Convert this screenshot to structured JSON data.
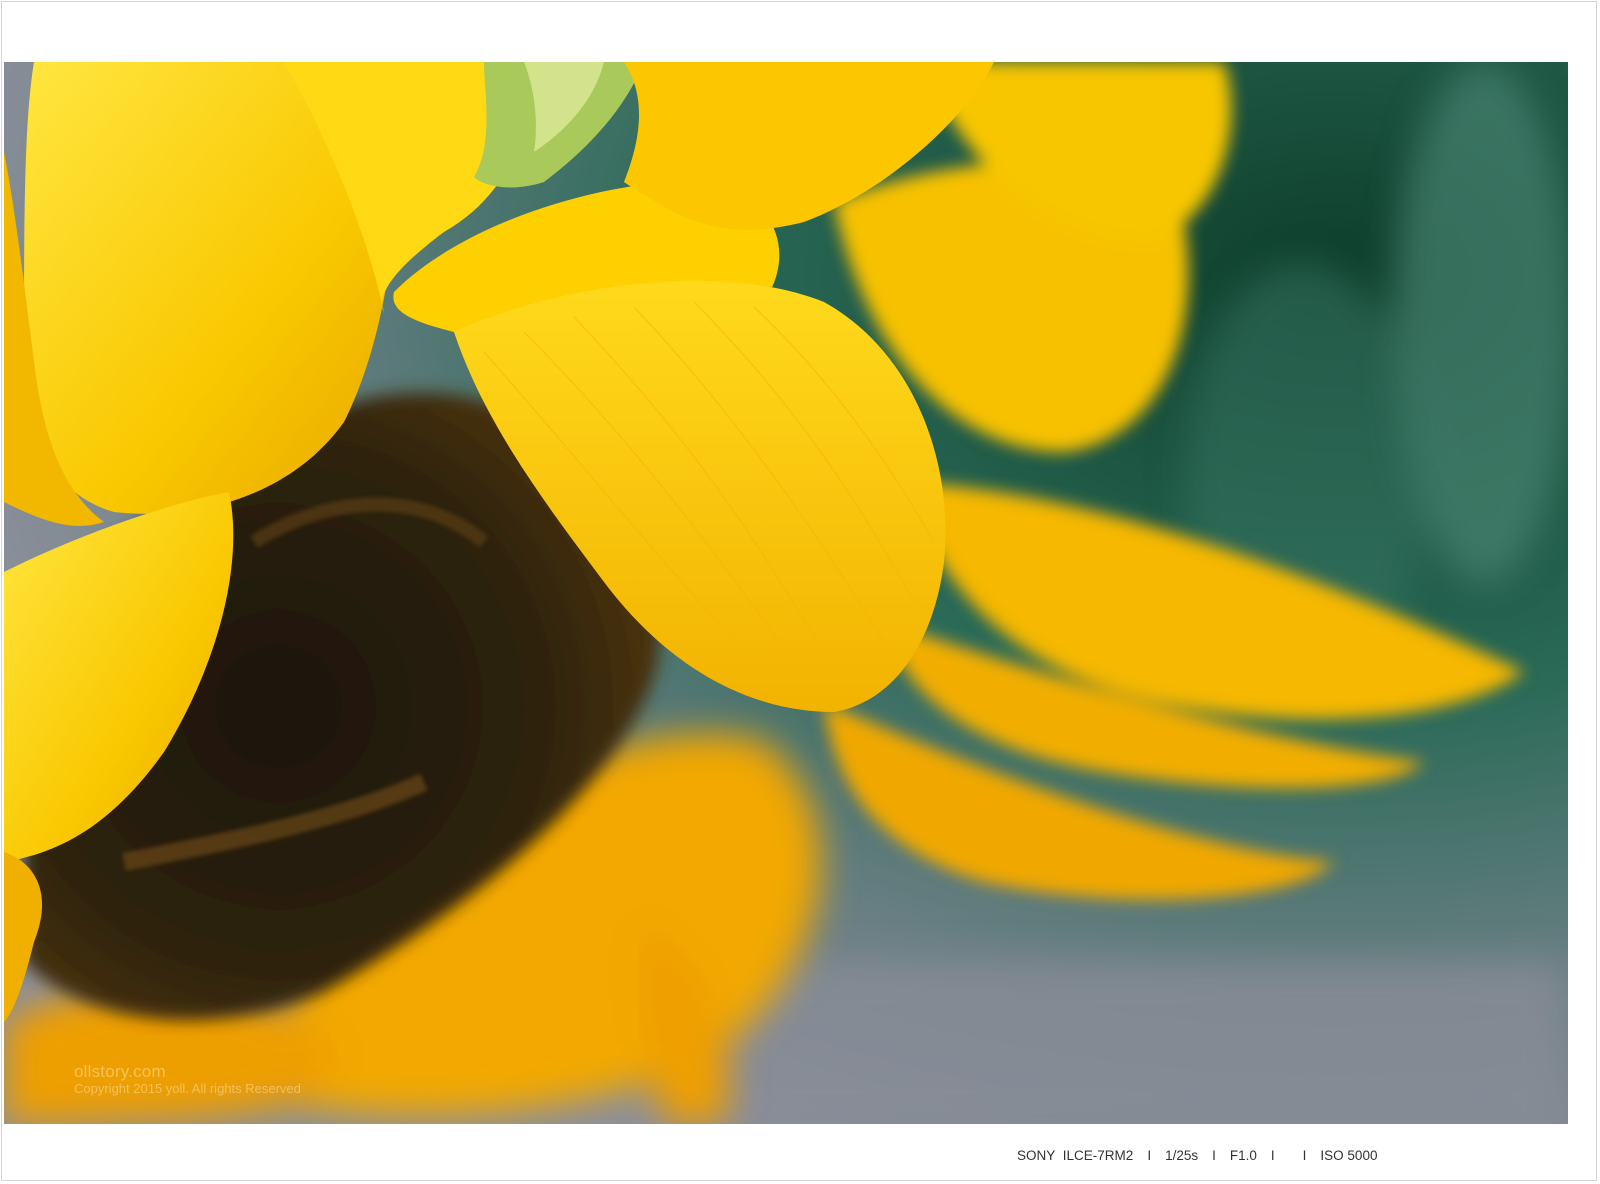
{
  "photo": {
    "subject_icon": "sunflower-photo",
    "colors": {
      "petal": "#f9c800",
      "petal_light": "#ffe23a",
      "petal_shadow": "#e8a200",
      "center": "#2a1f0c",
      "background_green": "#1b4f38",
      "background_gray": "#6f7e83"
    }
  },
  "watermark": {
    "site": "ollstory.com",
    "copyright": "Copyright 2015 yoll. All rights Reserved"
  },
  "exif": {
    "brand": "SONY",
    "model": "ILCE-7RM2",
    "shutter": "1/25s",
    "aperture": "F1.0",
    "iso": "ISO 5000",
    "separator": "I"
  }
}
